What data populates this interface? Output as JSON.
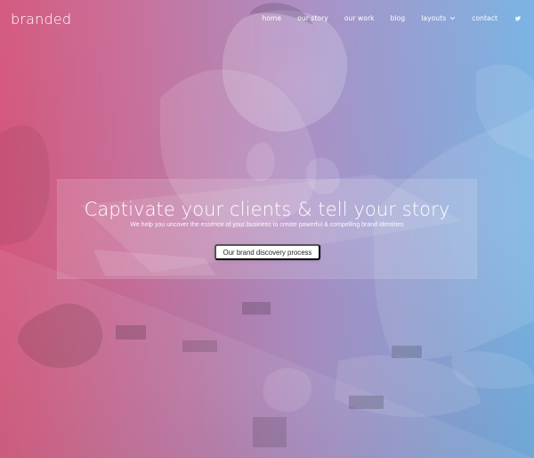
{
  "header": {
    "logo": "branded",
    "nav": {
      "home": "home",
      "our_story": "our story",
      "our_work": "our work",
      "blog": "blog",
      "layouts": "layouts",
      "contact": "contact"
    },
    "icons": {
      "dropdown": "chevron-down-icon",
      "social": "twitter-icon"
    }
  },
  "hero": {
    "title": "Captivate your clients & tell your story",
    "subtitle": "We help you uncover the essence of your business to create powerful & compelling brand identities",
    "cta_label": "Our brand discovery process"
  },
  "colors": {
    "overlay_left": "#db4a70",
    "overlay_mid": "#a88bc4",
    "overlay_right": "#6eb6e8",
    "text": "#ffffff",
    "button_bg": "#ffffff",
    "button_text": "#1f1f1f"
  }
}
